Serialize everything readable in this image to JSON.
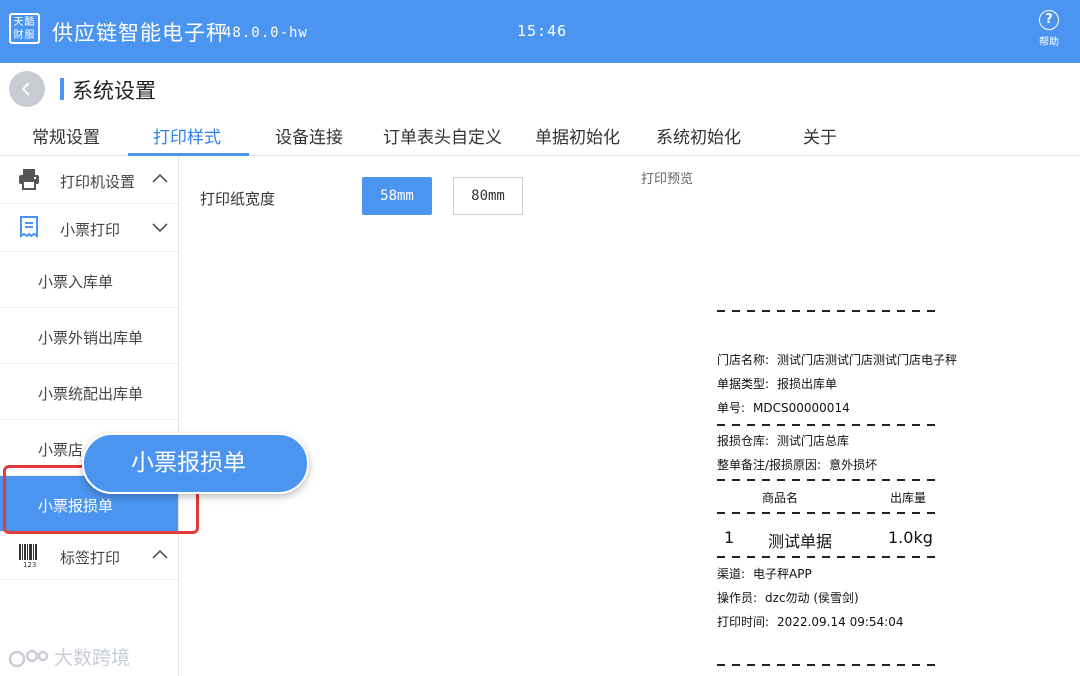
{
  "topbar": {
    "logo_text": [
      "天酷",
      "财服"
    ],
    "app_title": "供应链智能电子秤",
    "version": "48.0.0-hw",
    "time": "15:46",
    "help_icon_glyph": "?",
    "help_label": "帮助",
    "background_color": "#4b95f0"
  },
  "header": {
    "back_icon": "chevron-left-icon",
    "page_title": "系统设置"
  },
  "tabs": [
    {
      "label": "常规设置",
      "active": false
    },
    {
      "label": "打印样式",
      "active": true
    },
    {
      "label": "设备连接",
      "active": false
    },
    {
      "label": "订单表头自定义",
      "active": false
    },
    {
      "label": "单据初始化",
      "active": false
    },
    {
      "label": "系统初始化",
      "active": false
    },
    {
      "label": "关于",
      "active": false
    }
  ],
  "sidebar": {
    "groups": [
      {
        "label": "打印机设置",
        "icon": "printer-icon",
        "expanded": false
      },
      {
        "label": "小票打印",
        "icon": "receipt-icon",
        "expanded": true
      },
      {
        "label": "标签打印",
        "icon": "barcode-icon",
        "expanded": false
      }
    ],
    "barcode_digits": "123",
    "receipt_items": [
      "小票入库单",
      "小票外销出库单",
      "小票统配出库单",
      "小票店",
      "小票报损单"
    ],
    "active_item": "小票报损单"
  },
  "callout": {
    "label": "小票报损单"
  },
  "settings": {
    "paper_width_label": "打印纸宽度",
    "options": [
      "58mm",
      "80mm"
    ],
    "selected": "58mm"
  },
  "preview": {
    "title": "打印预览",
    "store": {
      "key": "门店名称:",
      "value": "测试门店测试门店测试门店电子秤"
    },
    "doc_type": {
      "key": "单据类型:",
      "value": "报损出库单"
    },
    "doc_no": {
      "key": "单号:",
      "value": "MDCS00000014"
    },
    "warehouse": {
      "key": "报损仓库:",
      "value": "测试门店总库"
    },
    "remark": {
      "key": "整单备注/报损原因:",
      "value": "意外损坏"
    },
    "columns": [
      "商品名",
      "出库量"
    ],
    "row": {
      "index": "1",
      "name": "测试单据",
      "qty": "1.0kg"
    },
    "channel": {
      "key": "渠道:",
      "value": "电子秤APP"
    },
    "operator": {
      "key": "操作员:",
      "value": "dzc勿动 (侯雪剑)"
    },
    "print_time": {
      "key": "打印时间:",
      "value": "2022.09.14 09:54:04"
    }
  },
  "watermark": {
    "text": "大数跨境",
    "icon": "brand-logo-icon"
  }
}
